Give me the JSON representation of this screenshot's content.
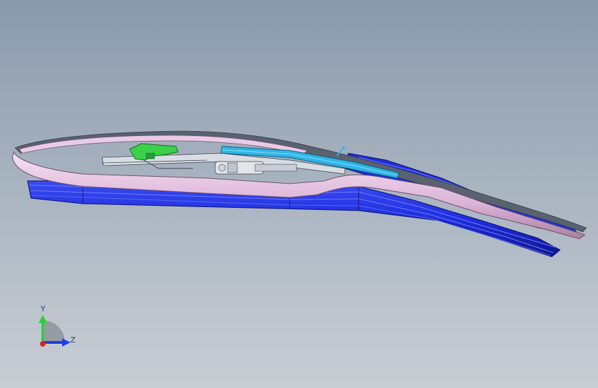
{
  "viewport": {
    "background_top": "#8a9aac",
    "background_bottom": "#c9ced4"
  },
  "model": {
    "parts": [
      "frame-rail-pink",
      "blue-lower-seals",
      "blue-top-strip",
      "cyan-top-strip",
      "green-bracket",
      "motor-assembly",
      "dark-edge-trim"
    ],
    "colors": {
      "frame": "#e3bfe0",
      "seal": "#1f2ee0",
      "seal_dark": "#0d148f",
      "cyan": "#2fb7e6",
      "green": "#3ad04a",
      "trim": "#555e6c"
    }
  },
  "triad": {
    "y_label": "Y",
    "z_label": "Z",
    "y_color": "#2fcf3f",
    "z_color": "#1d3fe0",
    "origin_color": "#e02020"
  }
}
